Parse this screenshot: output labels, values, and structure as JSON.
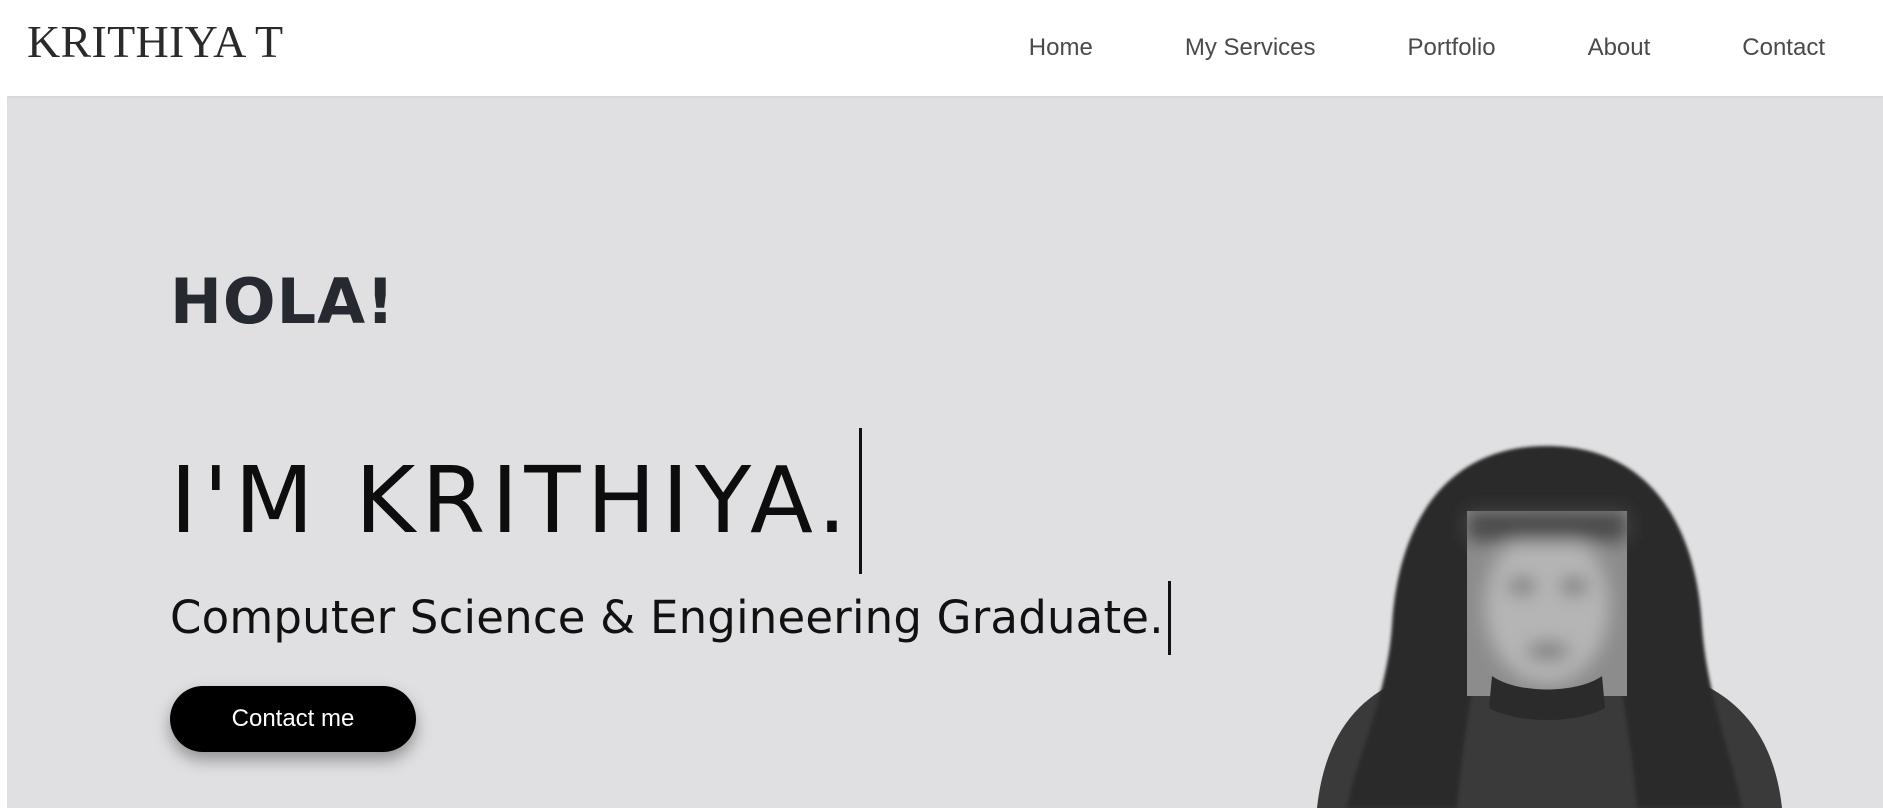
{
  "nav": {
    "brand": "KRITHIYA T",
    "links": [
      "Home",
      "My Services",
      "Portfolio",
      "About",
      "Contact"
    ]
  },
  "hero": {
    "greeting": "HOLA!",
    "headline": "I'M KRITHIYA.",
    "subtitle": "Computer Science & Engineering Graduate.",
    "cta_label": "Contact me"
  },
  "colors": {
    "hero_background": "#e0e0e2",
    "nav_background": "#ffffff",
    "button_background": "#000000",
    "button_text": "#ffffff"
  }
}
